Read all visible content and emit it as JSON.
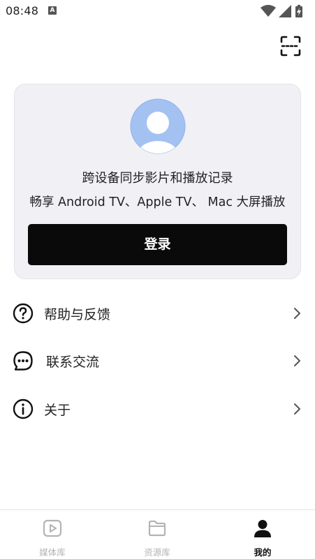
{
  "status_bar": {
    "time": "08:48",
    "notification_badge": "A",
    "icons": [
      "wifi-icon",
      "signal-icon",
      "battery-icon"
    ]
  },
  "header": {
    "scan_icon": "scan-icon"
  },
  "login_card": {
    "avatar_icon": "user-avatar-icon",
    "sync_text": "跨设备同步影片和播放记录",
    "devices_text": "畅享 Android TV、Apple TV、 Mac 大屏播放",
    "login_button_label": "登录"
  },
  "menu": {
    "items": [
      {
        "label": "帮助与反馈",
        "icon": "help-icon"
      },
      {
        "label": "联系交流",
        "icon": "chat-icon"
      },
      {
        "label": "关于",
        "icon": "info-icon"
      }
    ]
  },
  "bottom_nav": {
    "tabs": [
      {
        "label": "媒体库",
        "icon": "play-icon",
        "active": false
      },
      {
        "label": "资源库",
        "icon": "folder-icon",
        "active": false
      },
      {
        "label": "我的",
        "icon": "person-icon",
        "active": true
      }
    ]
  },
  "colors": {
    "card_background": "#f1f0f5",
    "button_background": "#0a0a0a",
    "avatar": "#a3c2f2",
    "inactive_nav": "#b3b3b3"
  }
}
